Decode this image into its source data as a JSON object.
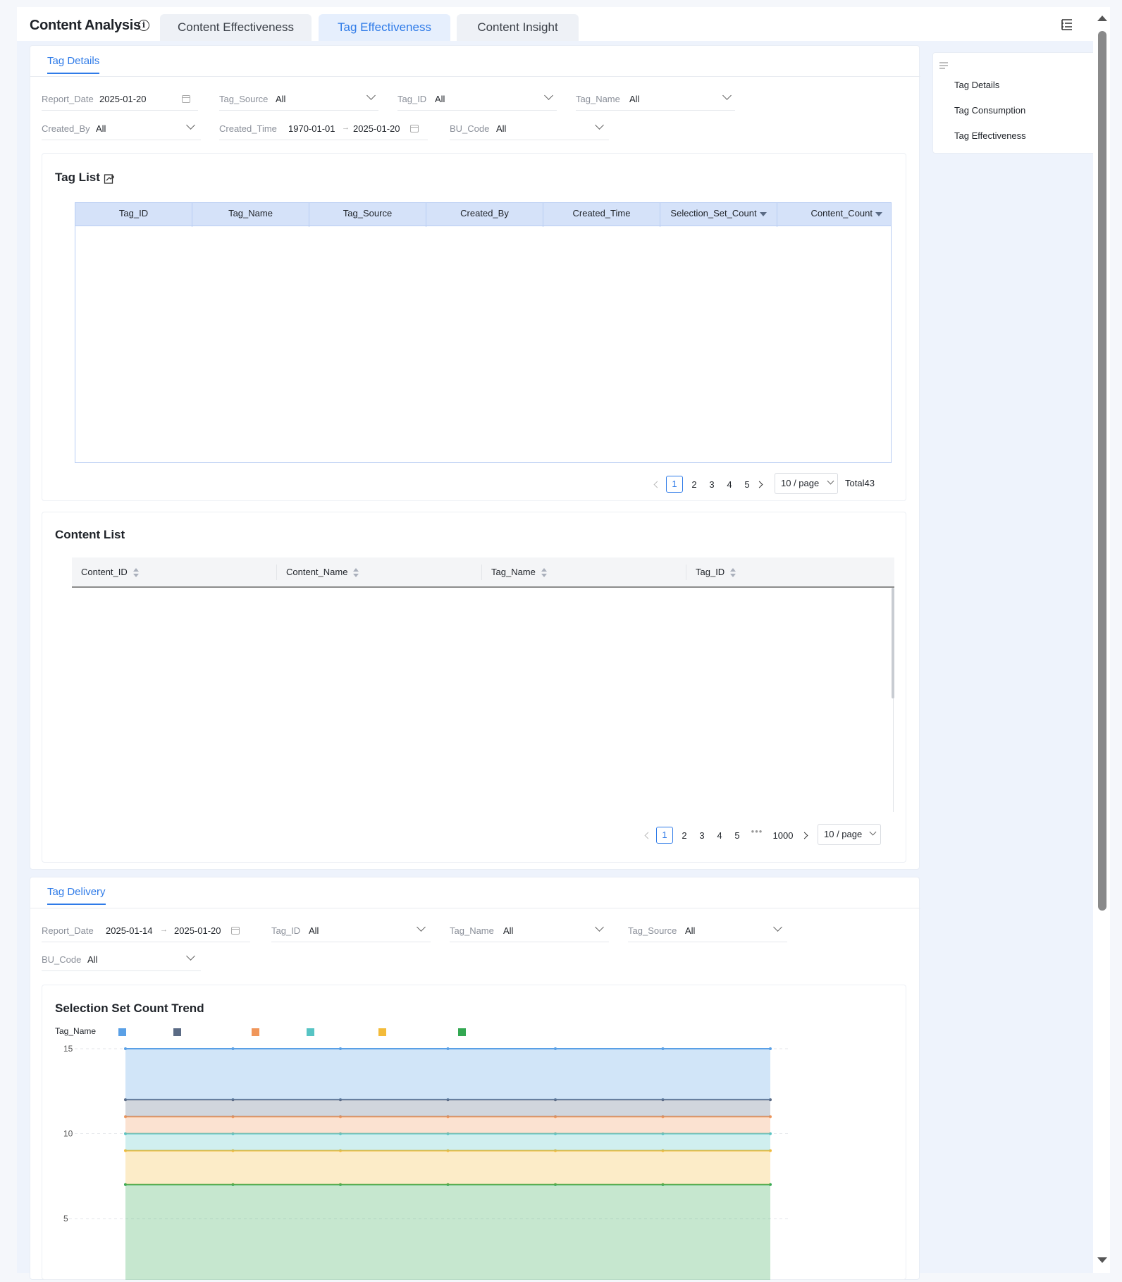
{
  "header": {
    "title": "Content Analysis",
    "tabs": [
      {
        "label": "Content Effectiveness",
        "active": false
      },
      {
        "label": "Tag Effectiveness",
        "active": true
      },
      {
        "label": "Content Insight",
        "active": false
      }
    ]
  },
  "tag_details": {
    "tab_label": "Tag Details",
    "filters": {
      "report_date": {
        "label": "Report_Date",
        "value": "2025-01-20"
      },
      "tag_source": {
        "label": "Tag_Source",
        "value": "All"
      },
      "tag_id": {
        "label": "Tag_ID",
        "value": "All"
      },
      "tag_name": {
        "label": "Tag_Name",
        "value": "All"
      },
      "created_by": {
        "label": "Created_By",
        "value": "All"
      },
      "created_time": {
        "label": "Created_Time",
        "start": "1970-01-01",
        "end": "2025-01-20"
      },
      "bu_code": {
        "label": "BU_Code",
        "value": "All"
      }
    },
    "tag_list": {
      "title": "Tag List",
      "columns": [
        "Tag_ID",
        "Tag_Name",
        "Tag_Source",
        "Created_By",
        "Created_Time",
        "Selection_Set_Count",
        "Content_Count"
      ],
      "pagination": {
        "pages": [
          "1",
          "2",
          "3",
          "4",
          "5"
        ],
        "current": "1",
        "page_size": "10 / page",
        "total": "Total43"
      }
    },
    "content_list": {
      "title": "Content List",
      "columns": [
        "Content_ID",
        "Content_Name",
        "Tag_Name",
        "Tag_ID"
      ],
      "pagination": {
        "pages": [
          "1",
          "2",
          "3",
          "4",
          "5"
        ],
        "ellipsis": "•••",
        "last": "1000",
        "current": "1",
        "page_size": "10 / page"
      }
    }
  },
  "tag_delivery": {
    "tab_label": "Tag Delivery",
    "filters": {
      "report_date": {
        "label": "Report_Date",
        "start": "2025-01-14",
        "end": "2025-01-20"
      },
      "tag_id": {
        "label": "Tag_ID",
        "value": "All"
      },
      "tag_name": {
        "label": "Tag_Name",
        "value": "All"
      },
      "tag_source": {
        "label": "Tag_Source",
        "value": "All"
      },
      "bu_code": {
        "label": "BU_Code",
        "value": "All"
      }
    },
    "trend_title": "Selection Set Count Trend",
    "legend_label": "Tag_Name"
  },
  "outline": {
    "items": [
      "Tag Details",
      "Tag Consumption",
      "Tag Effectiveness"
    ]
  },
  "chart_data": {
    "type": "area",
    "title": "Selection Set Count Trend",
    "legend_title": "Tag_Name",
    "x_points": 7,
    "ylim": [
      0,
      15
    ],
    "yticks": [
      "15",
      "10",
      "5"
    ],
    "stacked": true,
    "grid": true,
    "series_colors": [
      "#5aa0e6",
      "#5b6b85",
      "#f0965a",
      "#57c4c4",
      "#f3bb3a",
      "#33a852"
    ],
    "series": [
      {
        "color": "#33a852",
        "values": [
          7,
          7,
          7,
          7,
          7,
          7,
          7
        ]
      },
      {
        "color": "#f3bb3a",
        "values": [
          2,
          2,
          2,
          2,
          2,
          2,
          2
        ]
      },
      {
        "color": "#57c4c4",
        "values": [
          1,
          1,
          1,
          1,
          1,
          1,
          1
        ]
      },
      {
        "color": "#f0965a",
        "values": [
          1,
          1,
          1,
          1,
          1,
          1,
          1
        ]
      },
      {
        "color": "#5b6b85",
        "values": [
          1,
          1,
          1,
          1,
          1,
          1,
          1
        ]
      },
      {
        "color": "#5aa0e6",
        "values": [
          3,
          3,
          3,
          3,
          3,
          3,
          3
        ]
      }
    ]
  }
}
